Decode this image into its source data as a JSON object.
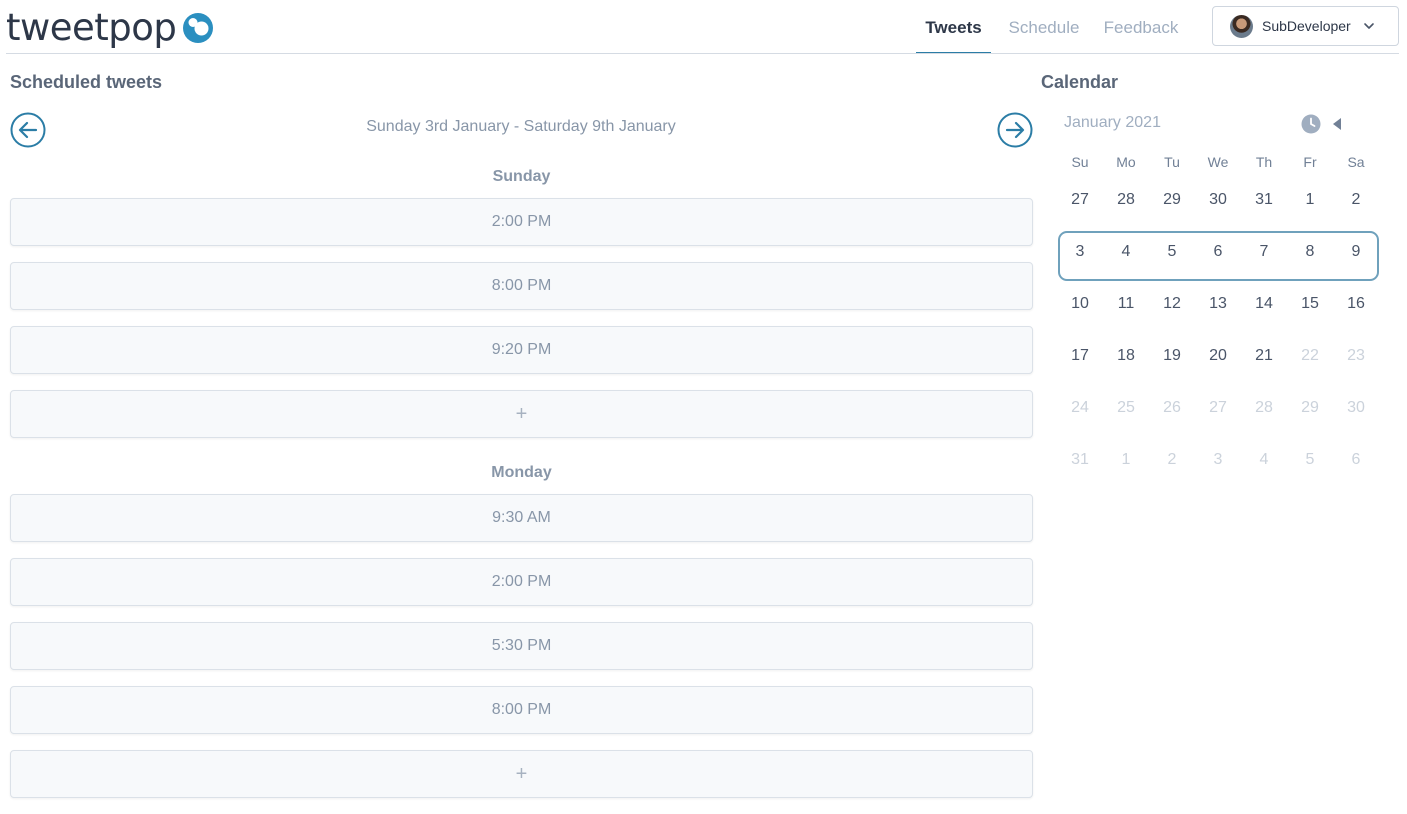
{
  "app": {
    "logo_text": "tweetpop"
  },
  "nav": {
    "tabs": [
      {
        "label": "Tweets",
        "active": true
      },
      {
        "label": "Schedule",
        "active": false
      },
      {
        "label": "Feedback",
        "active": false
      }
    ],
    "user": {
      "name": "SubDeveloper"
    }
  },
  "scheduled": {
    "title": "Scheduled tweets",
    "week_label": "Sunday 3rd January - Saturday 9th January",
    "days": [
      {
        "name": "Sunday",
        "slots": [
          "2:00 PM",
          "8:00 PM",
          "9:20 PM"
        ],
        "add_label": "+"
      },
      {
        "name": "Monday",
        "slots": [
          "9:30 AM",
          "2:00 PM",
          "5:30 PM",
          "8:00 PM"
        ],
        "add_label": "+"
      }
    ]
  },
  "calendar": {
    "title": "Calendar",
    "month_label": "January 2021",
    "weekdays": [
      "Su",
      "Mo",
      "Tu",
      "We",
      "Th",
      "Fr",
      "Sa"
    ],
    "weeks": [
      [
        "27",
        "28",
        "29",
        "30",
        "31",
        "1",
        "2"
      ],
      [
        "3",
        "4",
        "5",
        "6",
        "7",
        "8",
        "9"
      ],
      [
        "10",
        "11",
        "12",
        "13",
        "14",
        "15",
        "16"
      ],
      [
        "17",
        "18",
        "19",
        "20",
        "21",
        "22",
        "23"
      ],
      [
        "24",
        "25",
        "26",
        "27",
        "28",
        "29",
        "30"
      ],
      [
        "31",
        "1",
        "2",
        "3",
        "4",
        "5",
        "6"
      ]
    ],
    "selected_week_index": 1,
    "muted_from": {
      "row": 3,
      "col": 5
    }
  },
  "colors": {
    "accent": "#2b7da6",
    "text_dark": "#2d3748",
    "text_muted": "#8896a8",
    "highlight_border": "#6fa1bc"
  },
  "icons": {
    "logo_mark": "tweetpop-logo-icon",
    "prev_week": "arrow-left-circle-icon",
    "next_week": "arrow-right-circle-icon",
    "user_menu": "chevron-down-icon",
    "calendar_clock": "clock-icon",
    "calendar_prev": "caret-left-icon"
  }
}
